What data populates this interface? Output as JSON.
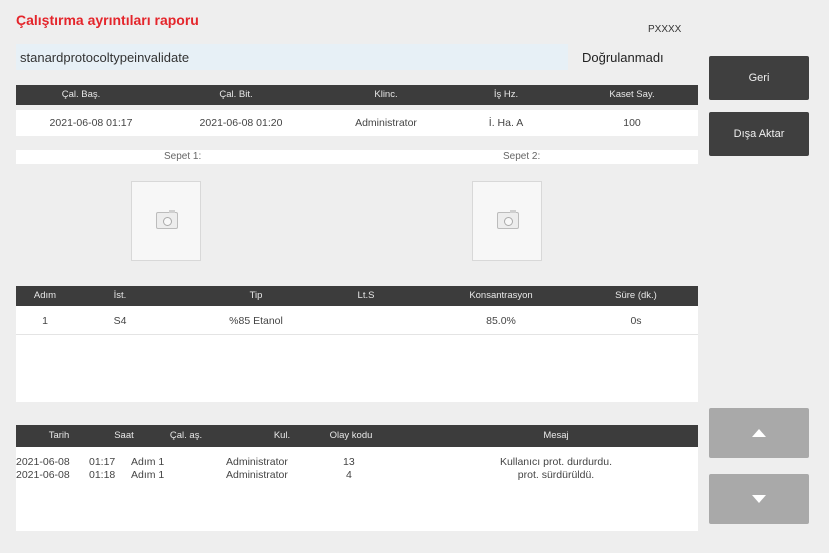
{
  "header": {
    "title": "Çalıştırma ayrıntıları raporu",
    "serial": "PXXXX",
    "protocol_name": "stanardprotocoltypeinvalidate",
    "validation_status": "Doğrulanmadı"
  },
  "run_table": {
    "columns": [
      "Çal. Baş.",
      "Çal. Bit.",
      "Klinc.",
      "İş Hz.",
      "Kaset Say."
    ],
    "row": [
      "2021-06-08 01:17",
      "2021-06-08 01:20",
      "Administrator",
      "İ. Ha. A",
      "100"
    ]
  },
  "baskets": {
    "basket1_label": "Sepet 1:",
    "basket2_label": "Sepet 2:"
  },
  "step_table": {
    "columns": [
      "Adım",
      "İst.",
      "Tip",
      "Lt.S",
      "Konsantrasyon",
      "Süre (dk.)"
    ],
    "rows": [
      [
        "1",
        "S4",
        "%85 Etanol",
        "",
        "85.0%",
        "0s"
      ]
    ]
  },
  "event_table": {
    "columns": [
      "Tarih",
      "Saat",
      "Çal. aş.",
      "Kul.",
      "Olay kodu",
      "Mesaj"
    ],
    "rows": [
      [
        "2021-06-08",
        "01:17",
        "Adım 1",
        "Administrator",
        "13",
        "Kullanıcı prot. durdurdu."
      ],
      [
        "2021-06-08",
        "01:18",
        "Adım 1",
        "Administrator",
        "4",
        "prot. sürdürüldü."
      ]
    ]
  },
  "buttons": {
    "back": "Geri",
    "export": "Dışa Aktar",
    "scroll_up_icon": "up-triangle",
    "scroll_down_icon": "down-triangle"
  },
  "colors": {
    "title": "#e4252b",
    "header_dark": "#3c3c3c",
    "button_dark": "#3f3f3f",
    "button_gray": "#a9a9a9"
  }
}
